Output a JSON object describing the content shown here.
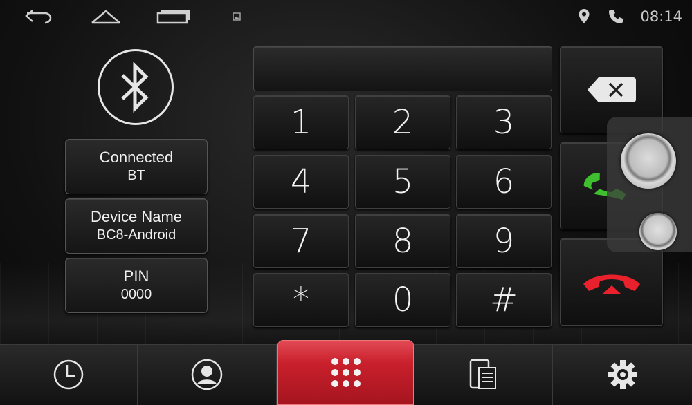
{
  "status_bar": {
    "time": "08:14",
    "icons": [
      "back-icon",
      "home-icon",
      "recent-apps-icon",
      "image-notification-icon",
      "location-icon",
      "phone-status-icon"
    ]
  },
  "bluetooth": {
    "icon": "bluetooth-icon",
    "connection": {
      "label": "Connected",
      "value": "BT"
    },
    "device": {
      "label": "Device Name",
      "value": "BC8-Android"
    },
    "pin": {
      "label": "PIN",
      "value": "0000"
    }
  },
  "dialer": {
    "number": "",
    "keys": [
      "1",
      "2",
      "3",
      "4",
      "5",
      "6",
      "7",
      "8",
      "9",
      "*",
      "0",
      "#"
    ]
  },
  "actions": {
    "backspace_icon": "backspace-icon",
    "call_icon": "call-icon",
    "hangup_icon": "hangup-icon"
  },
  "bottom_nav": {
    "tabs": [
      "call-history-icon",
      "contacts-icon",
      "dialpad-icon",
      "messages-icon",
      "settings-icon"
    ],
    "active": "dialpad-icon"
  },
  "colors": {
    "call_green": "#3fbf2f",
    "hangup_red": "#e8212d",
    "active_tab_red": "#c9202c"
  }
}
